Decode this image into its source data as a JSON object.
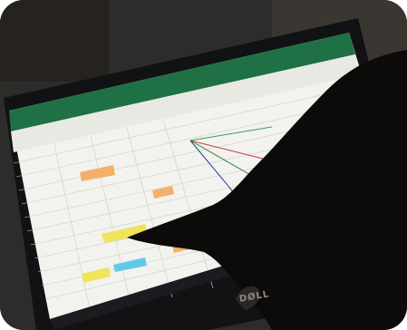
{
  "brand": {
    "logo_text": "DØLL"
  },
  "scene": {
    "colors": {
      "background": "#2e2c2a",
      "bezel": "#111213",
      "ribbon": "#1f7145",
      "sheet": "#f2f2ee",
      "highlight_orange": "#f3b06b",
      "highlight_yellow": "#efe45a",
      "highlight_blue": "#63c9ea",
      "hand": "#0d0b0a"
    }
  }
}
